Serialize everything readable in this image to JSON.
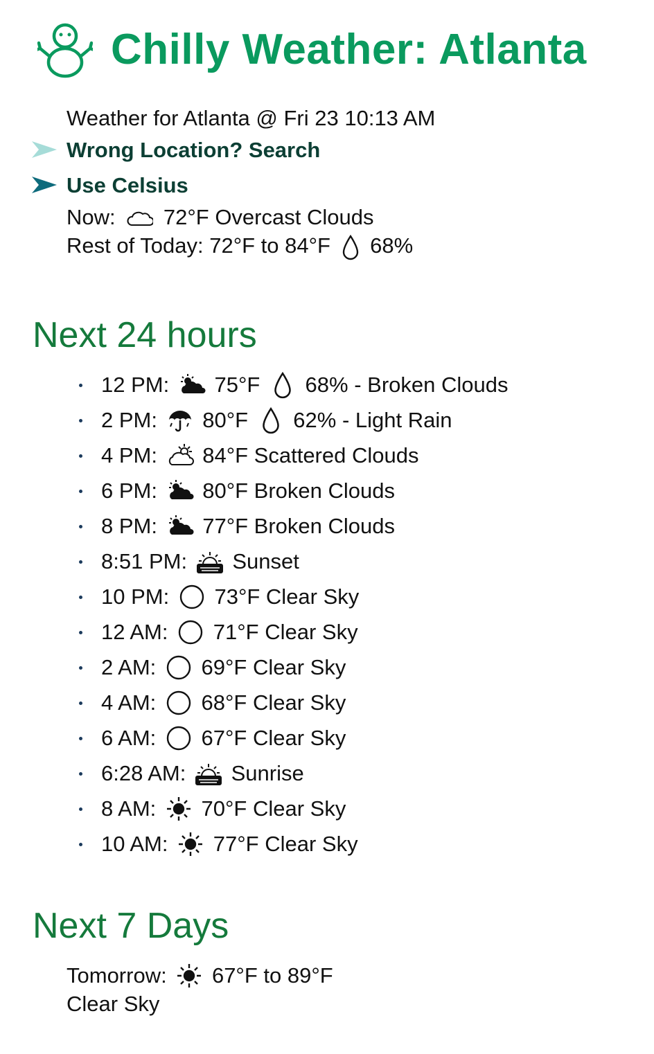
{
  "app": {
    "title": "Chilly Weather: Atlanta",
    "brand_color": "#0a9a5e",
    "section_color": "#157a3c",
    "logo": "snowman-icon"
  },
  "current": {
    "weather_for": "Weather for Atlanta @ Fri 23 10:13 AM",
    "search_link": "Wrong Location? Search",
    "celsius_link": "Use Celsius",
    "now_label": "Now:",
    "now_icon": "cloud-icon",
    "now_text": "72°F Overcast Clouds",
    "rest_label": "Rest of Today: 72°F to 84°F",
    "rest_precip": "68%"
  },
  "next24": {
    "heading": "Next 24 hours",
    "items": [
      {
        "time": "12 PM:",
        "icon": "broken-clouds-icon",
        "temp": "75°F",
        "precip": "68%",
        "desc": "- Broken Clouds"
      },
      {
        "time": "2 PM:",
        "icon": "umbrella-rain-icon",
        "temp": "80°F",
        "precip": "62%",
        "desc": "- Light Rain"
      },
      {
        "time": "4 PM:",
        "icon": "scattered-clouds-icon",
        "temp": "84°F",
        "precip": null,
        "desc": "Scattered Clouds"
      },
      {
        "time": "6 PM:",
        "icon": "broken-clouds-icon",
        "temp": "80°F",
        "precip": null,
        "desc": "Broken Clouds"
      },
      {
        "time": "8 PM:",
        "icon": "broken-clouds-icon",
        "temp": "77°F",
        "precip": null,
        "desc": "Broken Clouds"
      },
      {
        "time": "8:51 PM:",
        "icon": "sunset-icon",
        "temp": null,
        "precip": null,
        "desc": "Sunset"
      },
      {
        "time": "10 PM:",
        "icon": "clear-night-icon",
        "temp": "73°F",
        "precip": null,
        "desc": "Clear Sky"
      },
      {
        "time": "12 AM:",
        "icon": "clear-night-icon",
        "temp": "71°F",
        "precip": null,
        "desc": "Clear Sky"
      },
      {
        "time": "2 AM:",
        "icon": "clear-night-icon",
        "temp": "69°F",
        "precip": null,
        "desc": "Clear Sky"
      },
      {
        "time": "4 AM:",
        "icon": "clear-night-icon",
        "temp": "68°F",
        "precip": null,
        "desc": "Clear Sky"
      },
      {
        "time": "6 AM:",
        "icon": "clear-night-icon",
        "temp": "67°F",
        "precip": null,
        "desc": "Clear Sky"
      },
      {
        "time": "6:28 AM:",
        "icon": "sunrise-icon",
        "temp": null,
        "precip": null,
        "desc": "Sunrise"
      },
      {
        "time": "8 AM:",
        "icon": "sun-icon",
        "temp": "70°F",
        "precip": null,
        "desc": "Clear Sky"
      },
      {
        "time": "10 AM:",
        "icon": "sun-icon",
        "temp": "77°F",
        "precip": null,
        "desc": "Clear Sky"
      }
    ]
  },
  "next7": {
    "heading": "Next 7 Days",
    "days": [
      {
        "label": "Tomorrow:",
        "icon": "sun-icon",
        "range": "67°F to 89°F",
        "desc": "Clear Sky"
      }
    ]
  }
}
